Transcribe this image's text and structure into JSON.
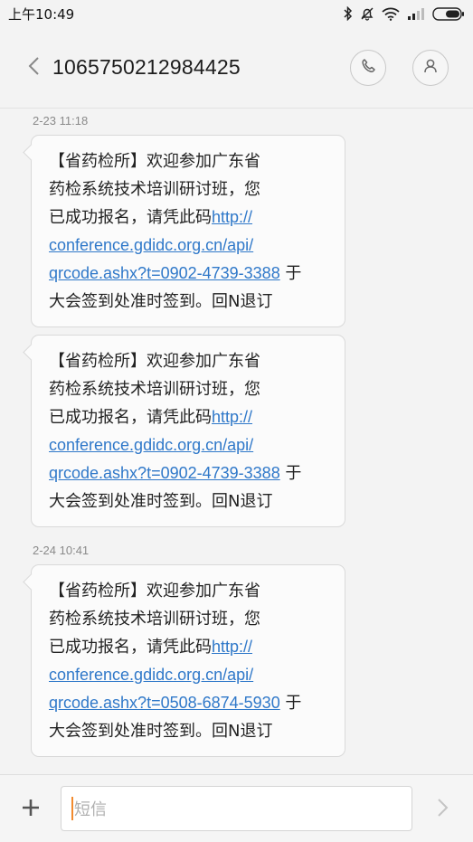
{
  "status_bar": {
    "time": "上午10:49",
    "icons": [
      "bluetooth-icon",
      "alarm-off-icon",
      "wifi-icon",
      "signal-icon",
      "battery-icon"
    ]
  },
  "header": {
    "contact": "1065750212984425",
    "back_icon": "chevron-left-icon",
    "call_icon": "phone-icon",
    "contact_icon": "person-icon"
  },
  "messages": [
    {
      "timestamp": "2-23 11:18",
      "lines": [
        "【省药检所】欢迎参加广东省",
        "药检系统技术培训研讨班，您"
      ],
      "pre_link": "已成功报名，请凭此码",
      "link_1": "http://",
      "link_2": "conference.gdidc.org.cn/api/",
      "link_3": "qrcode.ashx?t=0902-4739-3388",
      "post_link": " 于",
      "last_line": "大会签到处准时签到。回N退订"
    },
    {
      "timestamp": "",
      "lines": [
        "【省药检所】欢迎参加广东省",
        "药检系统技术培训研讨班，您"
      ],
      "pre_link": "已成功报名，请凭此码",
      "link_1": "http://",
      "link_2": "conference.gdidc.org.cn/api/",
      "link_3": "qrcode.ashx?t=0902-4739-3388",
      "post_link": " 于",
      "last_line": "大会签到处准时签到。回N退订"
    },
    {
      "timestamp": "2-24 10:41",
      "lines": [
        "【省药检所】欢迎参加广东省",
        "药检系统技术培训研讨班，您"
      ],
      "pre_link": "已成功报名，请凭此码",
      "link_1": "http://",
      "link_2": "conference.gdidc.org.cn/api/",
      "link_3": "qrcode.ashx?t=0508-6874-5930",
      "post_link": " 于",
      "last_line": "大会签到处准时签到。回N退订"
    }
  ],
  "composer": {
    "placeholder": "短信",
    "add_icon": "plus-icon",
    "send_icon": "chevron-right-icon"
  }
}
